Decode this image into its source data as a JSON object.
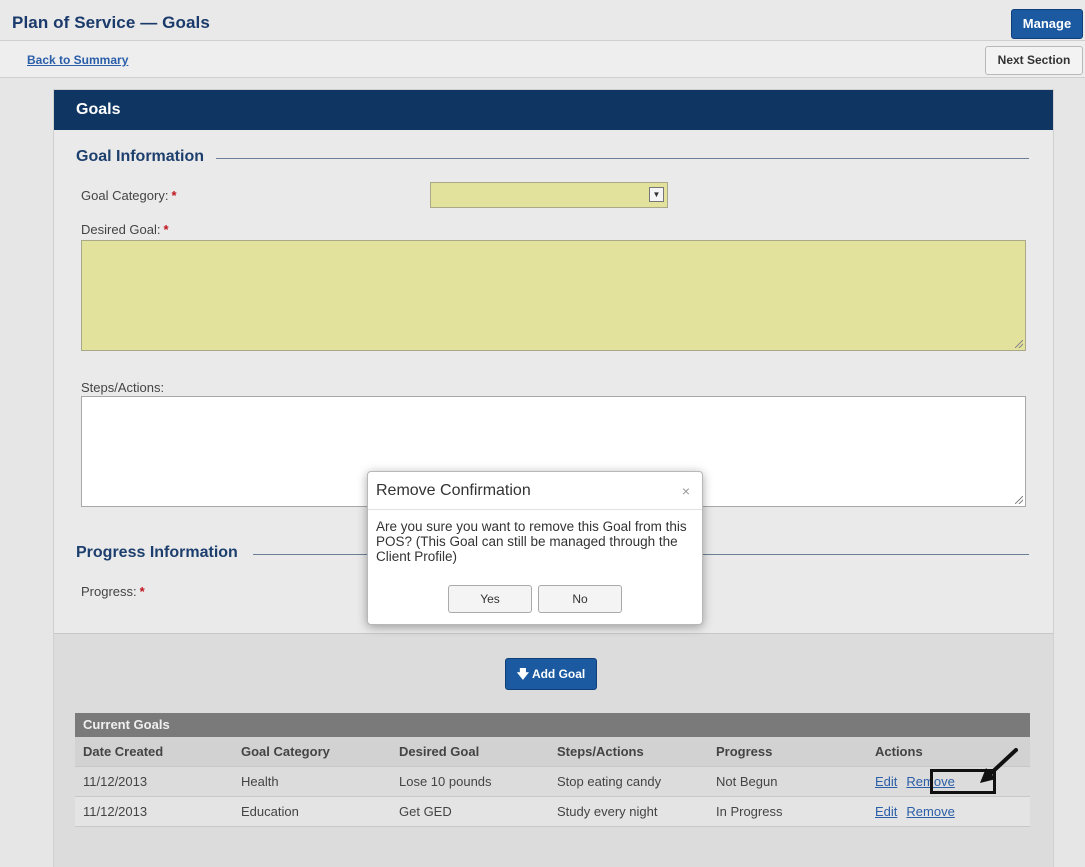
{
  "header": {
    "title": "Plan of Service — Goals",
    "manage_label": "Manage",
    "back_link": "Back to Summary",
    "next_label": "Next Section"
  },
  "panel": {
    "title": "Goals",
    "goal_info_legend": "Goal Information",
    "goal_category_label": "Goal Category:",
    "desired_goal_label": "Desired Goal:",
    "steps_label": "Steps/Actions:",
    "progress_info_legend": "Progress Information",
    "progress_label": "Progress:",
    "required_mark": "*",
    "add_goal_label": "Add Goal"
  },
  "current_goals": {
    "caption": "Current Goals",
    "columns": [
      "Date Created",
      "Goal Category",
      "Desired Goal",
      "Steps/Actions",
      "Progress",
      "Actions"
    ],
    "rows": [
      {
        "date": "11/12/2013",
        "category": "Health",
        "goal": "Lose 10 pounds",
        "steps": "Stop eating candy",
        "progress": "Not Begun",
        "edit": "Edit",
        "remove": "Remove"
      },
      {
        "date": "11/12/2013",
        "category": "Education",
        "goal": "Get GED",
        "steps": "Study every night",
        "progress": "In Progress",
        "edit": "Edit",
        "remove": "Remove"
      }
    ]
  },
  "modal": {
    "title": "Remove Confirmation",
    "close": "×",
    "message": "Are you sure you want to remove this Goal from this POS? (This Goal can still be managed through the Client Profile)",
    "yes_label": "Yes",
    "no_label": "No"
  },
  "colors": {
    "brand_navy": "#0f3563",
    "button_blue": "#1b5aa0",
    "required_field": "#e3e29d",
    "required_star": "#c0141d"
  },
  "icons": {
    "select_arrow": "dropdown-arrow-icon",
    "add_goal": "down-arrow-icon",
    "annotation": "pointer-arrow-icon"
  }
}
